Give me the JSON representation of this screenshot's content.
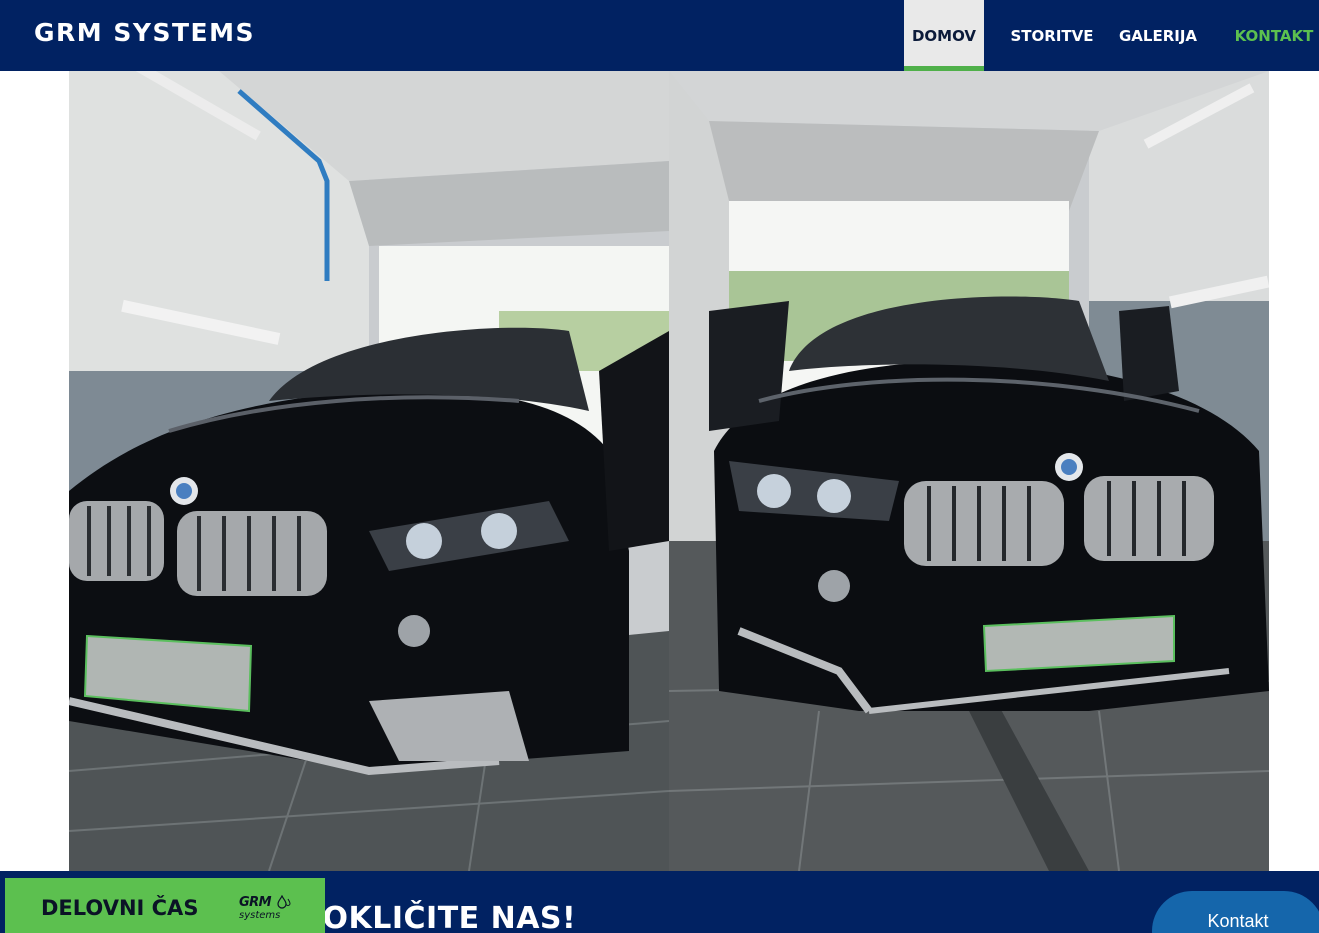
{
  "header": {
    "brand": "GRM SYSTEMS",
    "nav": [
      {
        "label": "DOMOV",
        "active": true
      },
      {
        "label": "STORITVE"
      },
      {
        "label": "GALERIJA"
      },
      {
        "label": "KONTAKT"
      }
    ]
  },
  "gallery": {
    "photos": [
      {
        "icon": "car-photo-left",
        "subject": "black BMW X5 front view in garage"
      },
      {
        "icon": "car-photo-right",
        "subject": "black BMW X5 front view in garage"
      }
    ]
  },
  "band": {
    "call_text": "POKLIČITE NAS!",
    "button": "Kontakt"
  },
  "hours_tab": {
    "label": "DELOVNI ČAS",
    "logo_top": "GRM",
    "logo_bottom": "systems"
  },
  "colors": {
    "navy": "#012262",
    "accent_green": "#5cc04f",
    "button_blue": "#1566ab",
    "active_bg": "#e9e9e9"
  }
}
